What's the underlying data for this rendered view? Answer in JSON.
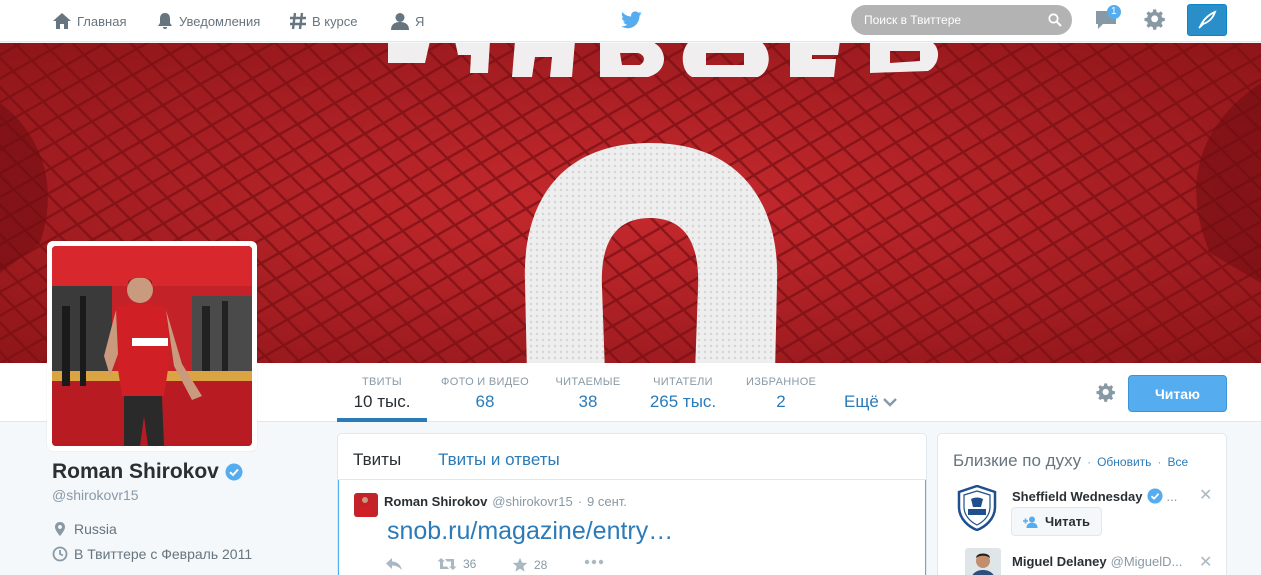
{
  "topbar": {
    "home": "Главная",
    "notifications": "Уведомления",
    "discover": "В курсе",
    "me": "Я",
    "search_placeholder": "Поиск в Твиттере",
    "messages_badge": "1"
  },
  "profile_nav": {
    "stats": [
      {
        "label": "ТВИТЫ",
        "value": "10 тыс."
      },
      {
        "label": "ФОТО И ВИДЕО",
        "value": "68"
      },
      {
        "label": "ЧИТАЕМЫЕ",
        "value": "38"
      },
      {
        "label": "ЧИТАТЕЛИ",
        "value": "265 тыс."
      },
      {
        "label": "ИЗБРАННОЕ",
        "value": "2"
      }
    ],
    "more": "Ещё",
    "follow_button": "Читаю"
  },
  "profile": {
    "name": "Roman Shirokov",
    "handle": "@shirokovr15",
    "location": "Russia",
    "joined": "В Твиттере с Февраль 2011"
  },
  "timeline": {
    "tabs": [
      "Твиты",
      "Твиты и ответы"
    ],
    "tweet": {
      "name": "Roman Shirokov",
      "handle": "@shirokovr15",
      "separator": "·",
      "date": "9 сент.",
      "link": "snob.ru/magazine/entry…",
      "retweets": "36",
      "favorites": "28"
    }
  },
  "who_to_follow": {
    "title": "Близкие по духу",
    "refresh": "Обновить",
    "dot": "·",
    "all": "Все",
    "suggestions": [
      {
        "name": "Sheffield Wednesday",
        "handle": "...",
        "button": "Читать"
      },
      {
        "name": "Miguel Delaney",
        "handle": "@MiguelD..."
      }
    ]
  },
  "colors": {
    "accent": "#55acee",
    "link": "#2b7bb9",
    "banner_red": "#b01c21"
  }
}
